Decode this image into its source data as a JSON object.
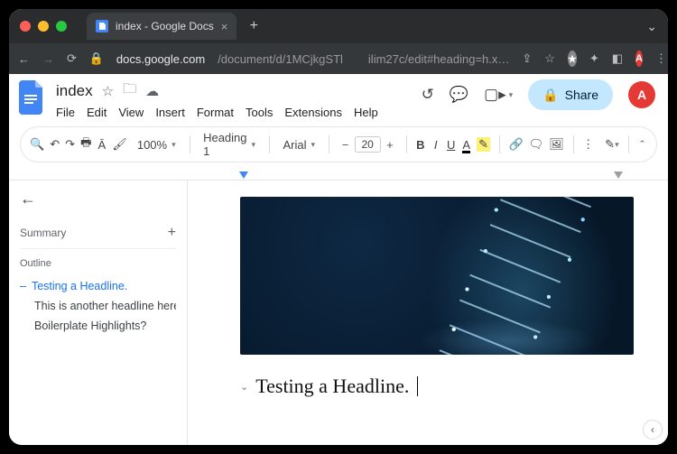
{
  "browser": {
    "tab_title": "index - Google Docs",
    "url_host": "docs.google.com",
    "url_path": "/document/d/1MCjkgSTl",
    "url_tail": "ilim27c/edit#heading=h.x…",
    "traffic_light_icons": [
      "close",
      "minimize",
      "zoom"
    ]
  },
  "docs": {
    "title": "index",
    "menus": [
      "File",
      "Edit",
      "View",
      "Insert",
      "Format",
      "Tools",
      "Extensions",
      "Help"
    ],
    "share_label": "Share",
    "avatar_letter": "A"
  },
  "toolbar": {
    "zoom": "100%",
    "style": "Heading 1",
    "font": "Arial",
    "font_size": "20"
  },
  "outline": {
    "summary_label": "Summary",
    "section_label": "Outline",
    "items": [
      {
        "label": "Testing a Headline.",
        "active": true
      },
      {
        "label": "This is another headline here f…",
        "active": false
      },
      {
        "label": "Boilerplate Highlights?",
        "active": false
      }
    ]
  },
  "document": {
    "heading_text": "Testing a Headline."
  }
}
